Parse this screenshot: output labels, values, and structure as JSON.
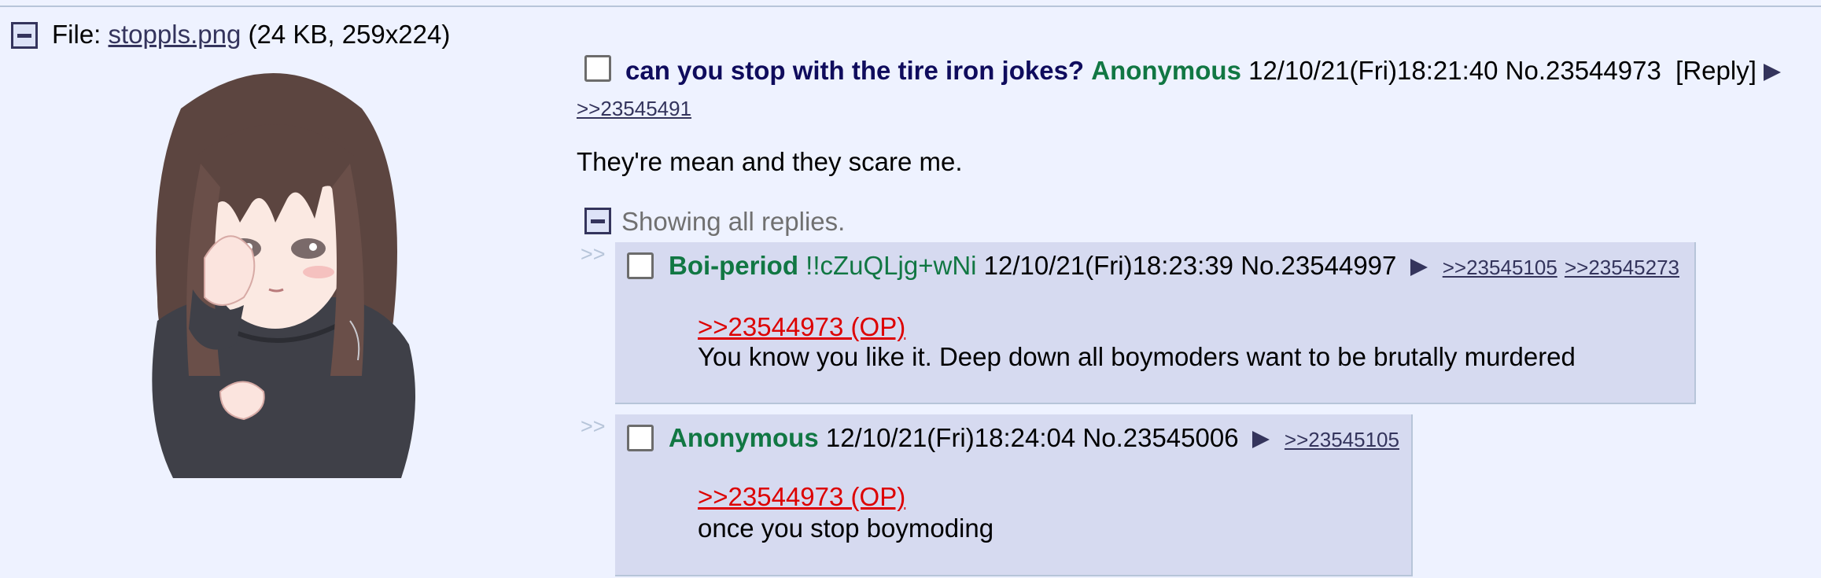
{
  "file": {
    "label": "File: ",
    "filename": "stoppls.png",
    "info": " (24 KB, 259x224)"
  },
  "op": {
    "subject": "can you stop with the tire iron jokes?",
    "name": "Anonymous",
    "datetime": "12/10/21(Fri)18:21:40",
    "number": "No.23544973",
    "reply_label": "[Reply]",
    "backlink": ">>23545491",
    "comment": "They're mean and they scare me."
  },
  "replies_toggle": {
    "label": "Showing all replies."
  },
  "replies": [
    {
      "sidearrows": ">>",
      "name": "Boi-period",
      "trip": "!!cZuQLjg+wNi",
      "datetime": "12/10/21(Fri)18:23:39",
      "number": "No.23544997",
      "backlinks": [
        ">>23545105",
        ">>23545273"
      ],
      "quote": ">>23544973 (OP)",
      "comment": "You know you like it. Deep down all boymoders want to be brutally murdered"
    },
    {
      "sidearrows": ">>",
      "name": "Anonymous",
      "datetime": "12/10/21(Fri)18:24:04",
      "number": "No.23545006",
      "backlinks": [
        ">>23545105"
      ],
      "quote": ">>23544973 (OP)",
      "comment": "once you stop boymoding"
    }
  ],
  "colors": {
    "background": "#eef2ff",
    "reply_bg": "#d6daf0",
    "name": "#117743",
    "subject": "#0f0c5d",
    "quote": "#dd0000",
    "link": "#34345c"
  }
}
